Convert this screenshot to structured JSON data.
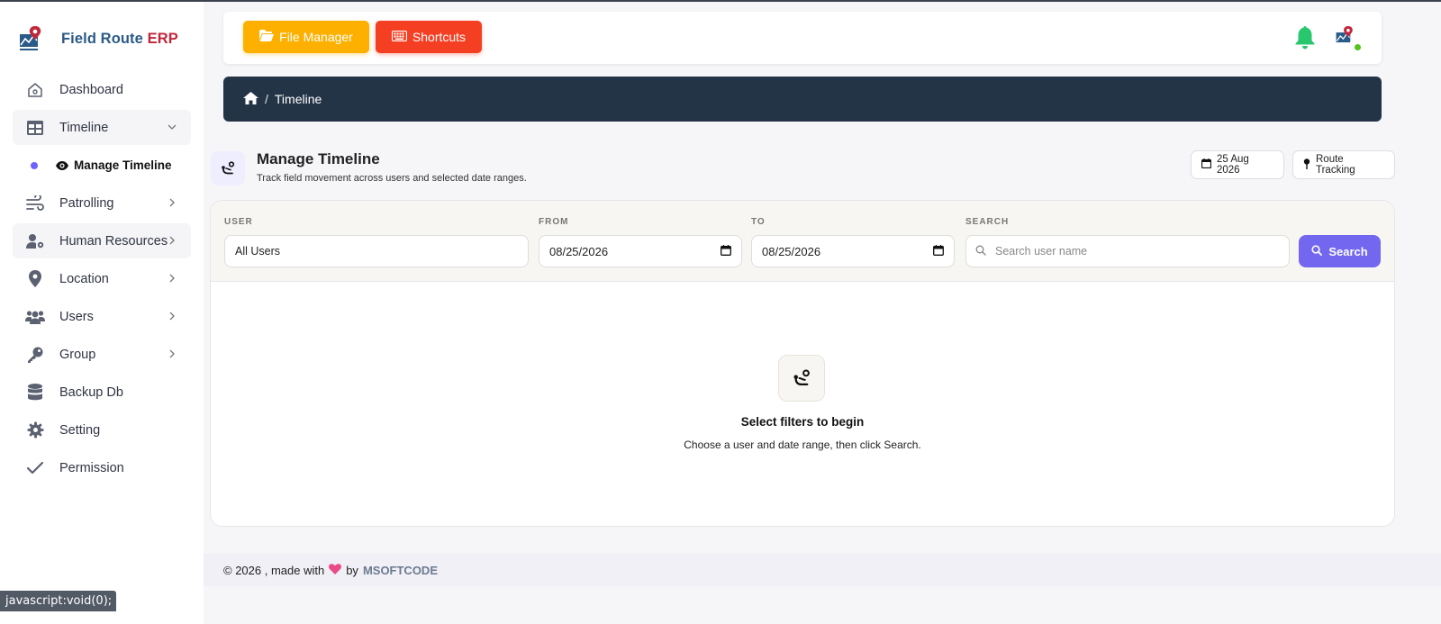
{
  "brand": {
    "name": "Field Route",
    "suffix": "ERP"
  },
  "sidebar": {
    "items": [
      {
        "label": "Dashboard",
        "icon": "home-icon"
      },
      {
        "label": "Timeline",
        "icon": "table-icon",
        "expanded": true
      },
      {
        "label": "Patrolling",
        "icon": "wind-icon"
      },
      {
        "label": "Human Resources",
        "icon": "user-gear-icon"
      },
      {
        "label": "Location",
        "icon": "map-pin-icon"
      },
      {
        "label": "Users",
        "icon": "users-icon"
      },
      {
        "label": "Group",
        "icon": "key-icon"
      },
      {
        "label": "Backup Db",
        "icon": "database-icon"
      },
      {
        "label": "Setting",
        "icon": "gear-icon"
      },
      {
        "label": "Permission",
        "icon": "check-icon"
      }
    ],
    "subitem": {
      "label": "Manage Timeline",
      "icon": "eye-icon"
    }
  },
  "topbar": {
    "file_manager_label": "File Manager",
    "shortcuts_label": "Shortcuts"
  },
  "breadcrumb": {
    "sep": "/",
    "current": "Timeline"
  },
  "page": {
    "title": "Manage Timeline",
    "subtitle": "Track field movement across users and selected date ranges.",
    "date_chip": "25 Aug 2026",
    "route_chip": "Route Tracking"
  },
  "filters": {
    "user_label": "USER",
    "user_value": "All Users",
    "from_label": "FROM",
    "from_value": "08/25/2026",
    "to_label": "TO",
    "to_value": "08/25/2026",
    "search_label": "SEARCH",
    "search_placeholder": "Search user name",
    "search_button": "Search"
  },
  "empty_state": {
    "title": "Select filters to begin",
    "subtitle": "Choose a user and date range, then click Search."
  },
  "footer": {
    "copyright": "© 2026 , made with",
    "by": "by",
    "company": "MSOFTCODE"
  },
  "status_bar": {
    "text": "javascript:void(0);"
  },
  "colors": {
    "accent": "#7367f0",
    "file_manager": "#fdb000",
    "shortcuts": "#f53f23",
    "breadcrumb_bg": "#243447",
    "bell": "#28c76f",
    "brand_blue": "#2a5a87",
    "brand_red": "#c0273a"
  }
}
